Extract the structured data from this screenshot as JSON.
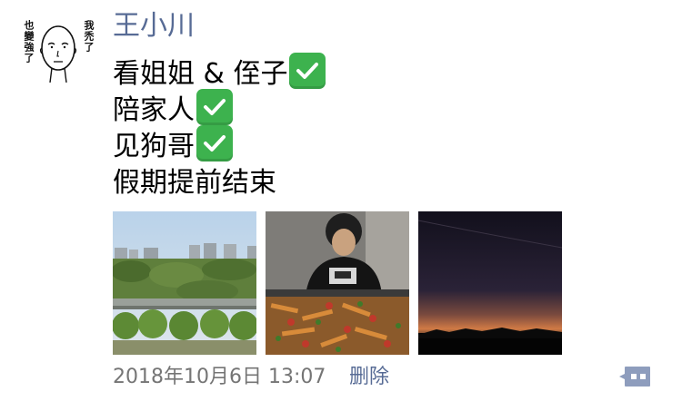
{
  "post": {
    "author": "王小川",
    "avatar": {
      "caption_left": "也變強了",
      "caption_right": "我禿了"
    },
    "lines": [
      {
        "text": "看姐姐 & 侄子",
        "check": true
      },
      {
        "text": "陪家人",
        "check": true
      },
      {
        "text": "见狗哥",
        "check": true
      },
      {
        "text": "假期提前结束",
        "check": false
      }
    ],
    "photos": [
      {
        "subject": "city-park-view"
      },
      {
        "subject": "person-with-food"
      },
      {
        "subject": "sunset-sky"
      }
    ],
    "timestamp": "2018年10月6日 13:07",
    "delete_label": "删除"
  },
  "icons": {
    "check": "check-mark-icon",
    "comment": "comment-dots-icon"
  },
  "colors": {
    "author": "#576b95",
    "check_bg": "#3db24e",
    "timestamp": "#757575",
    "link": "#576b95",
    "comment_btn": "#8e9dbd"
  }
}
